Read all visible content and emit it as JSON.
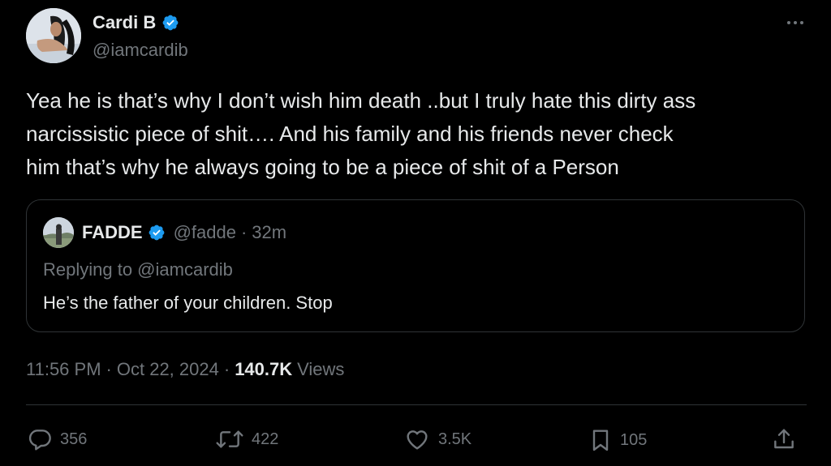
{
  "author": {
    "name": "Cardi B",
    "handle": "@iamcardib"
  },
  "tweet": {
    "text": "Yea he is that’s why I don’t wish him death ..but I truly hate this dirty ass\nnarcissistic piece of shit…. And his family and his friends never check\nhim that’s why he always going to be a piece of shit of a Person"
  },
  "quote": {
    "name": "FADDE",
    "handle": "@fadde",
    "separator": "·",
    "time": "32m",
    "replying_to": "Replying to @iamcardib",
    "text": "He’s the father of your children. Stop"
  },
  "meta": {
    "time": "11:56 PM",
    "separator": "·",
    "date": "Oct 22, 2024",
    "views_count": "140.7K",
    "views_label": "Views"
  },
  "actions": {
    "replies": "356",
    "reposts": "422",
    "likes": "3.5K",
    "bookmarks": "105"
  },
  "icons": {
    "verified": "verified-badge-icon",
    "more": "more-dots-icon",
    "reply": "reply-icon",
    "repost": "repost-icon",
    "like": "heart-icon",
    "bookmark": "bookmark-icon",
    "share": "share-icon"
  },
  "colors": {
    "background": "#000000",
    "text_primary": "#e7e9ea",
    "text_secondary": "#71767b",
    "border": "#2f3336",
    "verified_blue": "#1d9bf0"
  }
}
